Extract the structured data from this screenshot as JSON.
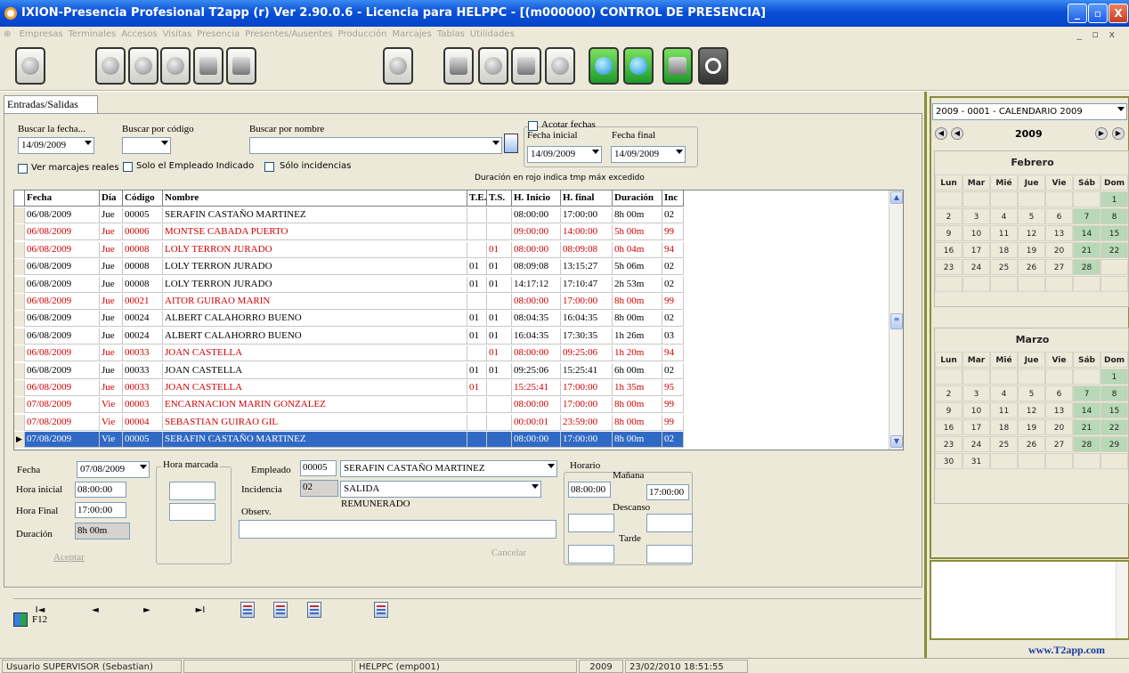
{
  "window": {
    "title": "IXION-Presencia Profesional T2app (r) Ver 2.90.0.6  -  Licencia para HELPPC - [(m000000)  CONTROL DE PRESENCIA]",
    "minimize": "_",
    "maximize": "▫",
    "close": "X"
  },
  "menu": {
    "items": [
      "Empresas",
      "Terminales",
      "Accesos",
      "Visitas",
      "Presencia",
      "Presentes/Ausentes",
      "Producción",
      "Marcajes",
      "Tablas",
      "Utilidades"
    ],
    "mdi_buttons": "_ ▫ x"
  },
  "toolbar": {
    "buttons": [
      "users-icon",
      "disk-icon",
      "info-icon",
      "settings-icon",
      "card-icon",
      "printer-icon",
      "globe-icon",
      "person-icon",
      "worker-icon",
      "calendar-icon",
      "clock-icon",
      "refresh-icon",
      "help-icon",
      "sheet-icon",
      "power-icon"
    ]
  },
  "tab": {
    "label": "Entradas/Salidas"
  },
  "search": {
    "fecha_label": "Buscar la fecha...",
    "fecha_value": "14/09/2009",
    "codigo_label": "Buscar por código",
    "codigo_value": "",
    "nombre_label": "Buscar por nombre",
    "nombre_value": "",
    "acotar_label": "Acotar fechas",
    "fecha_inicial_label": "Fecha inicial",
    "fecha_inicial_value": "14/09/2009",
    "fecha_final_label": "Fecha final",
    "fecha_final_value": "14/09/2009",
    "ver_marcajes": "Ver marcajes reales",
    "solo_empleado": "Solo el Empleado Indicado",
    "solo_incidencias": "Sólo incidencias",
    "duracion_nota": "Duración en rojo indica tmp máx excedido"
  },
  "grid": {
    "columns": [
      "Fecha",
      "Día",
      "Código",
      "Nombre",
      "T.E.",
      "T.S.",
      "H. Inicio",
      "H. final",
      "Duración",
      "Inc"
    ],
    "rows": [
      {
        "fecha": "06/08/2009",
        "dia": "Jue",
        "codigo": "00005",
        "nombre": "SERAFIN CASTAÑO MARTINEZ",
        "te": "",
        "ts": "",
        "inicio": "08:00:00",
        "final": "17:00:00",
        "duracion": "8h 00m",
        "inc": "02",
        "style": "normal"
      },
      {
        "fecha": "06/08/2009",
        "dia": "Jue",
        "codigo": "00006",
        "nombre": "MONTSE CABADA PUERTO",
        "te": "",
        "ts": "",
        "inicio": "09:00:00",
        "final": "14:00:00",
        "duracion": "5h 00m",
        "inc": "99",
        "style": "red"
      },
      {
        "fecha": "06/08/2009",
        "dia": "Jue",
        "codigo": "00008",
        "nombre": "LOLY TERRON JURADO",
        "te": "",
        "ts": "01",
        "inicio": "08:00:00",
        "final": "08:09:08",
        "duracion": "0h 04m",
        "inc": "94",
        "style": "red"
      },
      {
        "fecha": "06/08/2009",
        "dia": "Jue",
        "codigo": "00008",
        "nombre": "LOLY TERRON JURADO",
        "te": "01",
        "ts": "01",
        "inicio": "08:09:08",
        "final": "13:15:27",
        "duracion": "5h 06m",
        "inc": "02",
        "style": "normal"
      },
      {
        "fecha": "06/08/2009",
        "dia": "Jue",
        "codigo": "00008",
        "nombre": "LOLY TERRON JURADO",
        "te": "01",
        "ts": "01",
        "inicio": "14:17:12",
        "final": "17:10:47",
        "duracion": "2h 53m",
        "inc": "02",
        "style": "normal"
      },
      {
        "fecha": "06/08/2009",
        "dia": "Jue",
        "codigo": "00021",
        "nombre": "AITOR GUIRAO MARIN",
        "te": "",
        "ts": "",
        "inicio": "08:00:00",
        "final": "17:00:00",
        "duracion": "8h 00m",
        "inc": "99",
        "style": "red"
      },
      {
        "fecha": "06/08/2009",
        "dia": "Jue",
        "codigo": "00024",
        "nombre": "ALBERT CALAHORRO BUENO",
        "te": "01",
        "ts": "01",
        "inicio": "08:04:35",
        "final": "16:04:35",
        "duracion": "8h 00m",
        "inc": "02",
        "style": "normal"
      },
      {
        "fecha": "06/08/2009",
        "dia": "Jue",
        "codigo": "00024",
        "nombre": "ALBERT CALAHORRO BUENO",
        "te": "01",
        "ts": "01",
        "inicio": "16:04:35",
        "final": "17:30:35",
        "duracion": "1h 26m",
        "inc": "03",
        "style": "normal"
      },
      {
        "fecha": "06/08/2009",
        "dia": "Jue",
        "codigo": "00033",
        "nombre": "JOAN CASTELLA",
        "te": "",
        "ts": "01",
        "inicio": "08:00:00",
        "final": "09:25:06",
        "duracion": "1h 20m",
        "inc": "94",
        "style": "red"
      },
      {
        "fecha": "06/08/2009",
        "dia": "Jue",
        "codigo": "00033",
        "nombre": "JOAN CASTELLA",
        "te": "01",
        "ts": "01",
        "inicio": "09:25:06",
        "final": "15:25:41",
        "duracion": "6h 00m",
        "inc": "02",
        "style": "normal"
      },
      {
        "fecha": "06/08/2009",
        "dia": "Jue",
        "codigo": "00033",
        "nombre": "JOAN CASTELLA",
        "te": "01",
        "ts": "",
        "inicio": "15:25:41",
        "final": "17:00:00",
        "duracion": "1h 35m",
        "inc": "95",
        "style": "red"
      },
      {
        "fecha": "07/08/2009",
        "dia": "Vie",
        "codigo": "00003",
        "nombre": "ENCARNACION MARIN GONZALEZ",
        "te": "",
        "ts": "",
        "inicio": "08:00:00",
        "final": "17:00:00",
        "duracion": "8h 00m",
        "inc": "99",
        "style": "red"
      },
      {
        "fecha": "07/08/2009",
        "dia": "Vie",
        "codigo": "00004",
        "nombre": "SEBASTIAN GUIRAO GIL",
        "te": "",
        "ts": "",
        "inicio": "00:00:01",
        "final": "23:59:00",
        "duracion": "8h 00m",
        "inc": "99",
        "style": "red"
      },
      {
        "fecha": "07/08/2009",
        "dia": "Vie",
        "codigo": "00005",
        "nombre": "SERAFIN CASTAÑO MARTINEZ",
        "te": "",
        "ts": "",
        "inicio": "08:00:00",
        "final": "17:00:00",
        "duracion": "8h 00m",
        "inc": "02",
        "style": "sel"
      }
    ]
  },
  "detail": {
    "fecha_label": "Fecha",
    "fecha_value": "07/08/2009",
    "hora_inicial_label": "Hora inicial",
    "hora_inicial_value": "08:00:00",
    "hora_final_label": "Hora Final",
    "hora_final_value": "17:00:00",
    "duracion_label": "Duración",
    "duracion_value": "8h 00m",
    "hora_marcada_label": "Hora marcada",
    "empleado_label": "Empleado",
    "empleado_code": "00005",
    "empleado_name": "SERAFIN CASTAÑO MARTINEZ",
    "incidencia_label": "Incidencia",
    "incidencia_code": "02",
    "incidencia_name": "SALIDA",
    "remunerado": "REMUNERADO",
    "observ_label": "Observ.",
    "horario_label": "Horario",
    "manana_label": "Mañana",
    "manana_inicio": "08:00:00",
    "manana_fin": "17:00:00",
    "descanso_label": "Descanso",
    "tarde_label": "Tarde",
    "aceptar": "Aceptar",
    "cancelar": "Cancelar"
  },
  "nav": {
    "first": "I◄",
    "prev": "◄",
    "next": "►",
    "last": "►I"
  },
  "exit": {
    "label": "F12"
  },
  "calendar": {
    "selector": "2009 - 0001 - CALENDARIO 2009",
    "year": "2009",
    "weekdays": [
      "Lun",
      "Mar",
      "Mié",
      "Jue",
      "Vie",
      "Sáb",
      "Dom"
    ],
    "months": [
      {
        "name": "Febrero",
        "start": 6,
        "days": 28
      },
      {
        "name": "Marzo",
        "start": 6,
        "days": 31
      }
    ]
  },
  "website": "www.T2app.com",
  "status": {
    "user": "Usuario SUPERVISOR (Sebastian)",
    "host": "HELPPC  (emp001)",
    "year": "2009",
    "datetime": "23/02/2010  18:51:55"
  }
}
